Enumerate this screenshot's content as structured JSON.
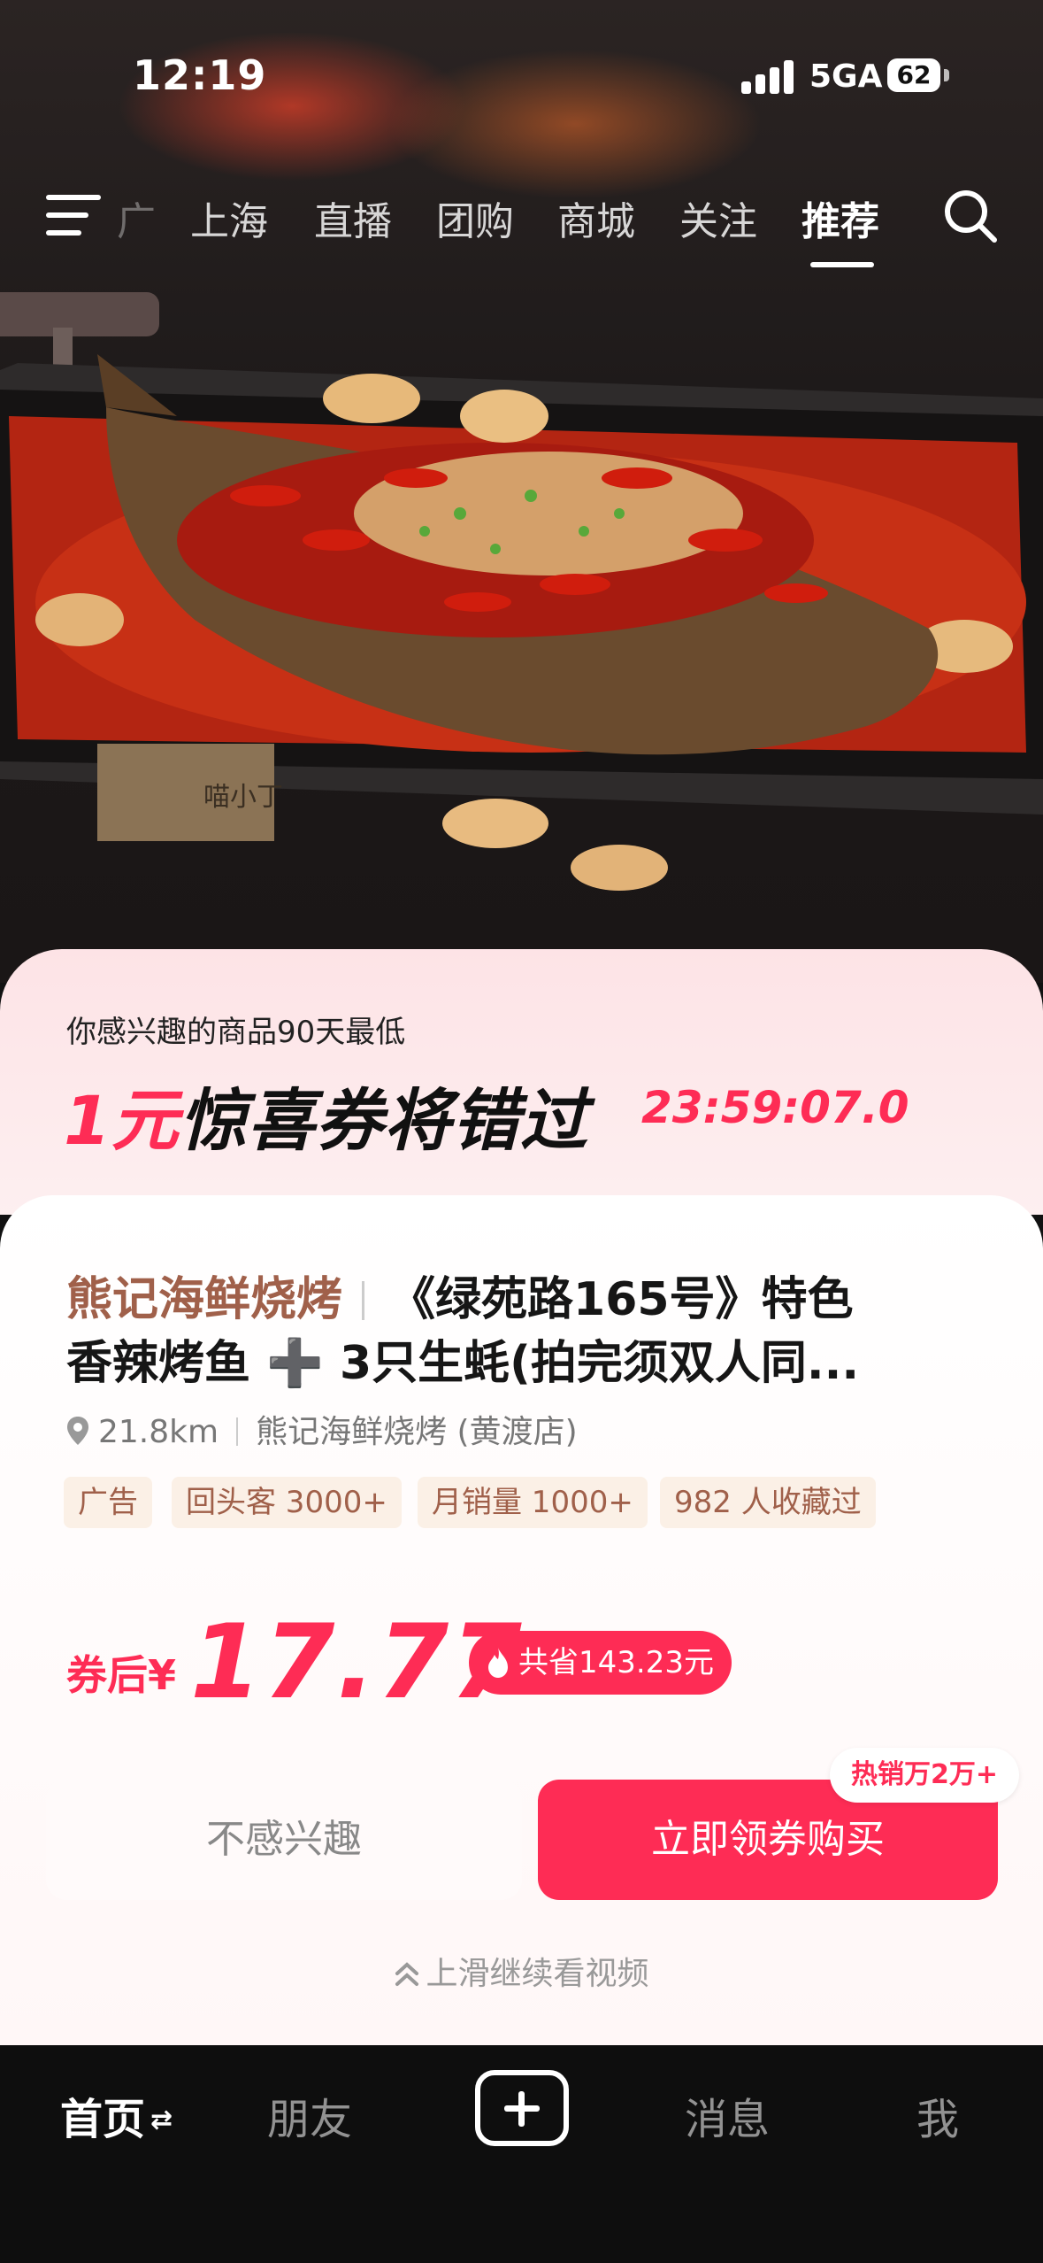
{
  "status_bar": {
    "time": "12:19",
    "network": "5GA",
    "battery": "62"
  },
  "top_nav": {
    "tabs": [
      {
        "label": "广",
        "active": false
      },
      {
        "label": "上海",
        "active": false
      },
      {
        "label": "直播",
        "active": false
      },
      {
        "label": "团购",
        "active": false
      },
      {
        "label": "商城",
        "active": false
      },
      {
        "label": "关注",
        "active": false
      },
      {
        "label": "推荐",
        "active": true
      }
    ]
  },
  "hero": {
    "plate_text": "喵小丁"
  },
  "promo": {
    "subtitle": "你感兴趣的商品90天最低",
    "title_highlight": "1元",
    "title_rest": "惊喜券将错过",
    "countdown": "23:59:07.0"
  },
  "product": {
    "shop_name": "熊记海鲜烧烤",
    "title_line1": "《绿苑路165号》特色",
    "title_line2": "香辣烤鱼 ➕ 3只生蚝(拍完须双人同...",
    "distance": "21.8km",
    "store": "熊记海鲜烧烤 (黄渡店)",
    "tags": [
      "广告",
      "回头客 3000+",
      "月销量 1000+",
      "982 人收藏过"
    ],
    "price_label": "券后¥",
    "price": "17.77",
    "savings": "共省143.23元",
    "hot_badge": "热销万2万+",
    "not_interested": "不感兴趣",
    "buy_label": "立即领券购买",
    "swipe_hint": "上滑继续看视频"
  },
  "tabbar": {
    "home": "首页",
    "friends": "朋友",
    "messages": "消息",
    "me": "我"
  },
  "colors": {
    "accent": "#fe2c55",
    "shop_brown": "#a0604a",
    "tag_bg": "#fbf0e6"
  }
}
